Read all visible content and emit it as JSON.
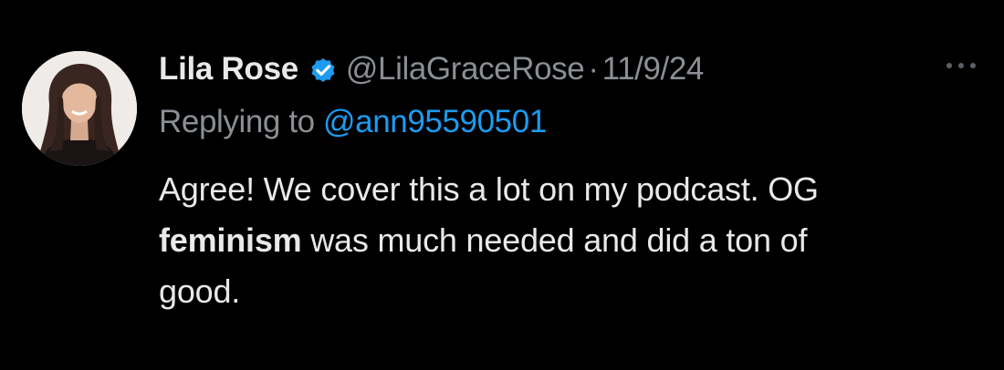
{
  "tweet": {
    "author": {
      "display_name": "Lila Rose",
      "verified_icon": "verified-badge-icon",
      "handle": "@LilaGraceRose",
      "separator": "·",
      "date": "11/9/24"
    },
    "reply": {
      "prefix": "Replying to ",
      "to": "@ann95590501"
    },
    "body": {
      "line1": "Agree! We cover this a lot on my podcast. OG",
      "emphasis": "feminism",
      "line2_rest": " was much needed and did a ton of",
      "line3": "good."
    },
    "more_icon": "more-options-icon"
  },
  "colors": {
    "background": "#000000",
    "primary_text": "#e7e9ea",
    "secondary_text": "#8b8f94",
    "link": "#1d9bf0",
    "verified": "#1d9bf0"
  }
}
